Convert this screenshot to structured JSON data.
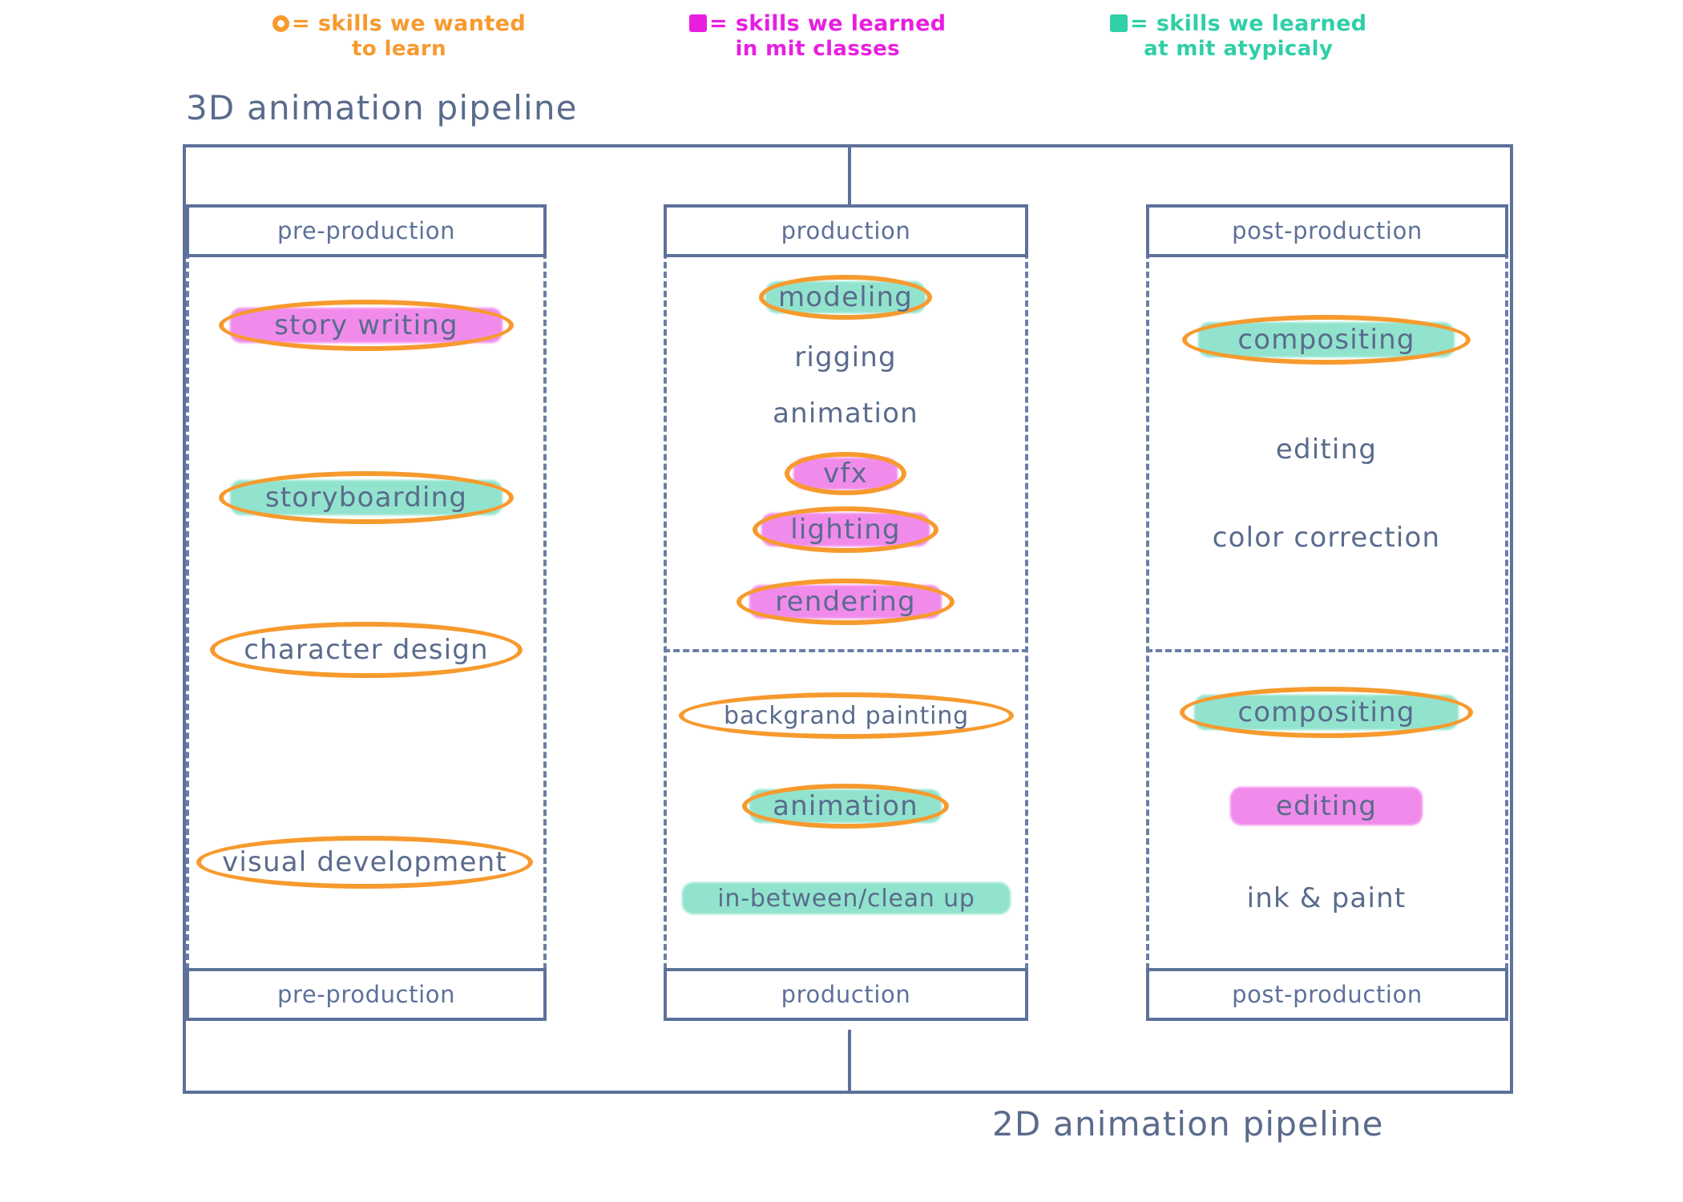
{
  "legend": {
    "items": [
      {
        "swatch": "ring-icon",
        "color": "#f79a2e",
        "line1": "= skills we wanted",
        "line2": "to learn"
      },
      {
        "swatch": "square-icon",
        "color": "#e81ee0",
        "line1": "= skills we learned",
        "line2": "in mit classes"
      },
      {
        "swatch": "square-icon",
        "color": "#2fcfa8",
        "line1": "= skills we learned",
        "line2": "at mit atypicaly"
      }
    ]
  },
  "titles": {
    "top": "3D animation pipeline",
    "bottom": "2D animation pipeline"
  },
  "headers": {
    "top": [
      "pre-production",
      "production",
      "post-production"
    ],
    "bottom": [
      "pre-production",
      "production",
      "post-production"
    ]
  },
  "columns": {
    "pre_production": {
      "label": "pre-production",
      "items": [
        {
          "text": "story writing",
          "highlight": "pink",
          "ring": true
        },
        {
          "text": "storyboarding",
          "highlight": "teal",
          "ring": true
        },
        {
          "text": "character design",
          "highlight": "none",
          "ring": true
        },
        {
          "text": "visual development",
          "highlight": "none",
          "ring": true
        }
      ]
    },
    "production_3d": {
      "label": "production",
      "items": [
        {
          "text": "modeling",
          "highlight": "teal",
          "ring": true
        },
        {
          "text": "rigging",
          "highlight": "none",
          "ring": false
        },
        {
          "text": "animation",
          "highlight": "none",
          "ring": false
        },
        {
          "text": "vfx",
          "highlight": "pink",
          "ring": true
        },
        {
          "text": "lighting",
          "highlight": "pink",
          "ring": true
        },
        {
          "text": "rendering",
          "highlight": "pink",
          "ring": true
        }
      ]
    },
    "production_2d": {
      "label": "production",
      "items": [
        {
          "text": "backgrand painting",
          "highlight": "none",
          "ring": true
        },
        {
          "text": "animation",
          "highlight": "teal",
          "ring": true
        },
        {
          "text": "in-between/clean up",
          "highlight": "teal",
          "ring": false
        }
      ]
    },
    "post_production_3d": {
      "label": "post-production",
      "items": [
        {
          "text": "compositing",
          "highlight": "teal",
          "ring": true
        },
        {
          "text": "editing",
          "highlight": "none",
          "ring": false
        },
        {
          "text": "color correction",
          "highlight": "none",
          "ring": false
        }
      ]
    },
    "post_production_2d": {
      "label": "post-production",
      "items": [
        {
          "text": "compositing",
          "highlight": "teal",
          "ring": true
        },
        {
          "text": "editing",
          "highlight": "pink",
          "ring": false
        },
        {
          "text": "ink & paint",
          "highlight": "none",
          "ring": false
        }
      ]
    }
  }
}
